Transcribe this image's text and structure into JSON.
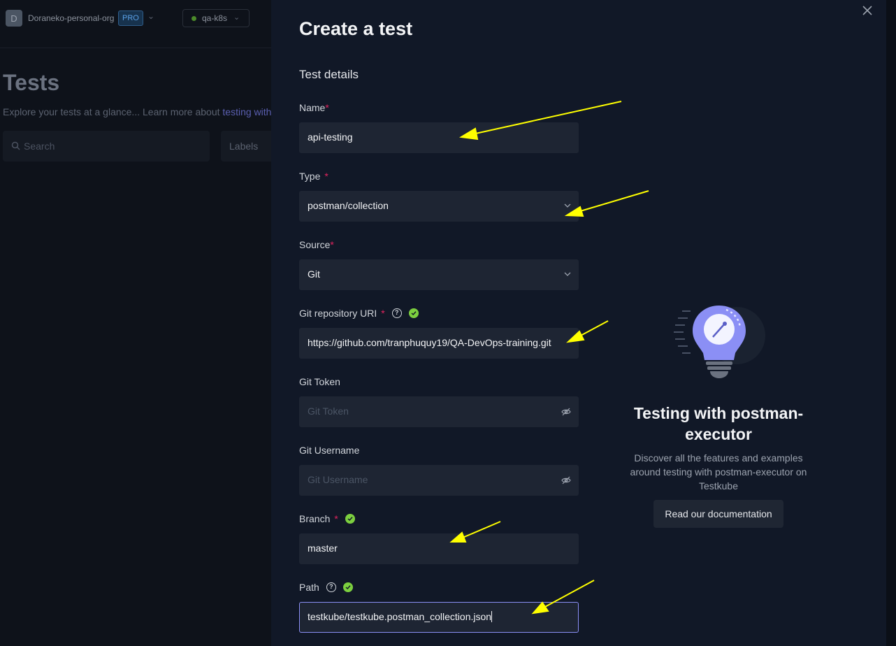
{
  "header": {
    "org_initial": "D",
    "org_name": "Doraneko-personal-org",
    "plan_badge": "PRO",
    "environment": "qa-k8s"
  },
  "background_page": {
    "title": "Tests",
    "subtitle": "Explore your tests at a glance... Learn more about",
    "subtitle_link": "testing with",
    "search_placeholder": "Search",
    "labels_filter": "Labels"
  },
  "drawer": {
    "title": "Create a test",
    "section": "Test details",
    "fields": {
      "name": {
        "label": "Name",
        "value": "api-testing"
      },
      "type": {
        "label": "Type",
        "value": "postman/collection"
      },
      "source": {
        "label": "Source",
        "value": "Git"
      },
      "repo": {
        "label": "Git repository URI",
        "value": "https://github.com/tranphuquy19/QA-DevOps-training.git"
      },
      "token": {
        "label": "Git Token",
        "placeholder": "Git Token"
      },
      "username": {
        "label": "Git Username",
        "placeholder": "Git Username"
      },
      "branch": {
        "label": "Branch",
        "value": "master"
      },
      "path": {
        "label": "Path",
        "value": "testkube/testkube.postman_collection.json"
      }
    },
    "required_mark": "*",
    "help_glyph": "?"
  },
  "info_panel": {
    "title": "Testing with postman-executor",
    "description": "Discover all the features and examples around testing with postman-executor on Testkube",
    "button": "Read our documentation",
    "icon": "lightbulb-postman-icon"
  },
  "colors": {
    "drawer_bg": "#111827",
    "field_bg": "#1e2533",
    "required": "#e0245e",
    "valid": "#7ccf3f",
    "focus_border": "#8b8ff5",
    "annotation_arrow": "#ffff00"
  }
}
